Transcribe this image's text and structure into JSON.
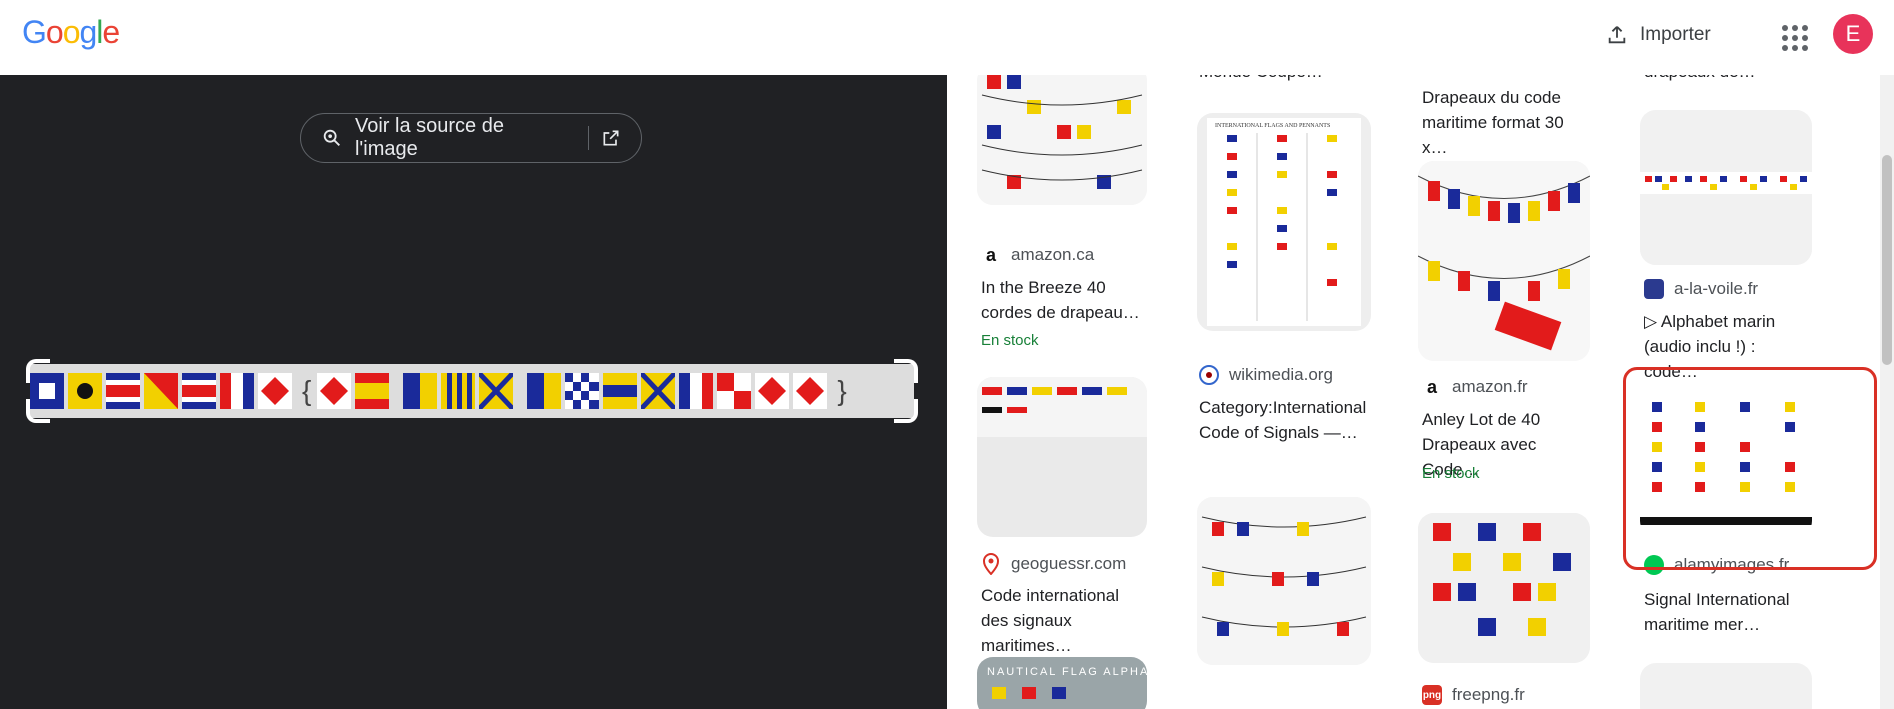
{
  "header": {
    "logo_letters": [
      "G",
      "o",
      "o",
      "g",
      "l",
      "e"
    ],
    "import_label": "Importer",
    "avatar_initial": "E"
  },
  "viewer": {
    "source_button_label": "Voir la source de l'image"
  },
  "results": {
    "col1": [
      {
        "source": "amazon.ca",
        "title": "In the Breeze 40 cordes de drapeau…",
        "stock": "En stock"
      },
      {
        "source": "geoguessr.com",
        "title": "Code international des signaux maritimes…"
      }
    ],
    "col2": [
      {
        "title_top": "Monde Coupe…"
      },
      {
        "source": "wikimedia.org",
        "title": "Category:International Code of Signals —…"
      }
    ],
    "col3": [
      {
        "title_top": "Drapeaux du code maritime format 30 x…"
      },
      {
        "source": "amazon.fr",
        "title": "Anley Lot de 40 Drapeaux avec Code…",
        "stock": "En stock"
      },
      {
        "source": "freepng.fr"
      }
    ],
    "col4": [
      {
        "title_top": "drapeaux de…"
      },
      {
        "source": "a-la-voile.fr",
        "title": "▷ Alphabet marin (audio inclu !) : code…"
      },
      {
        "source": "alamyimages.fr",
        "title": "Signal International maritime mer…"
      }
    ]
  },
  "colors": {
    "accent_red": "#d93025",
    "stock_green": "#188038",
    "dark_bg": "#202124",
    "avatar": "#e8335a"
  },
  "icons": [
    "upload-icon",
    "apps-grid-icon",
    "lens-search-icon",
    "open-in-new-icon",
    "amazon-icon",
    "location-pin-icon",
    "wikimedia-icon",
    "png-icon",
    "a-la-voile-icon",
    "alamy-icon"
  ]
}
